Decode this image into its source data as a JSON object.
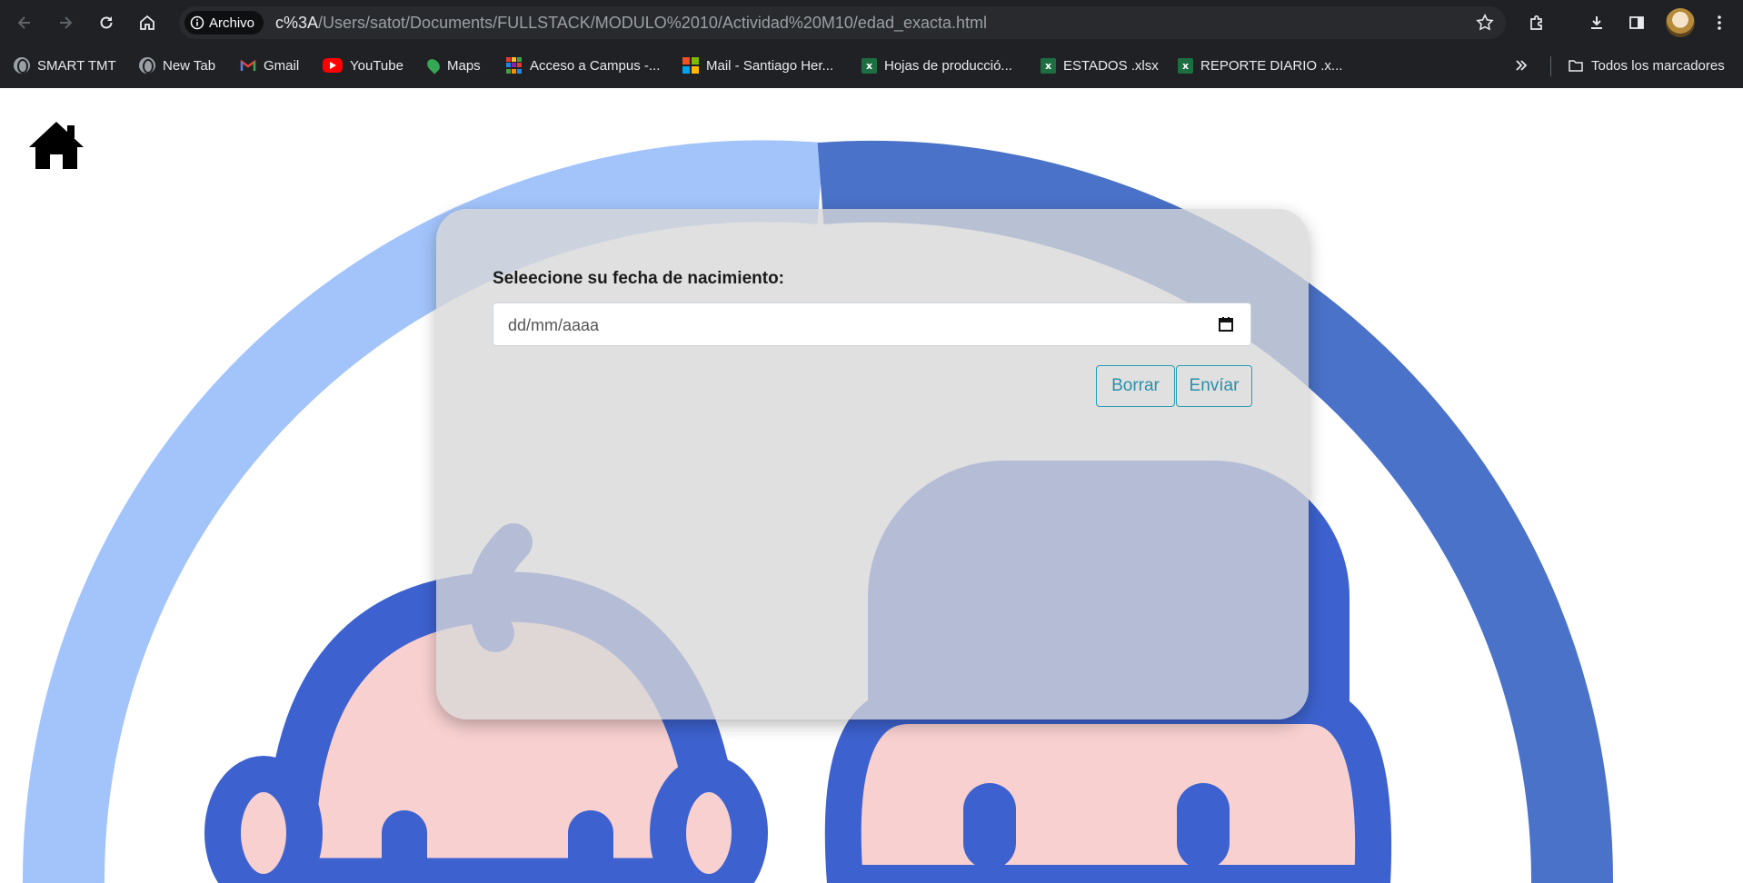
{
  "browser": {
    "site_chip": "Archivo",
    "url_host": "c%3A",
    "url_path": "/Users/satot/Documents/FULLSTACK/MODULO%2010/Actividad%20M10/edad_exacta.html",
    "bookmarks": [
      {
        "label": "SMART TMT",
        "icon": "globe-icon"
      },
      {
        "label": "New Tab",
        "icon": "globe-icon"
      },
      {
        "label": "Gmail",
        "icon": "gmail-icon"
      },
      {
        "label": "YouTube",
        "icon": "youtube-icon"
      },
      {
        "label": "Maps",
        "icon": "maps-icon"
      },
      {
        "label": "Acceso a Campus -...",
        "icon": "grid-icon"
      },
      {
        "label": "Mail - Santiago Her...",
        "icon": "microsoft-icon"
      },
      {
        "label": "Hojas de producció...",
        "icon": "excel-icon"
      },
      {
        "label": "ESTADOS .xlsx",
        "icon": "excel-icon"
      },
      {
        "label": "REPORTE DIARIO .x...",
        "icon": "excel-icon"
      }
    ],
    "all_bookmarks": "Todos los marcadores"
  },
  "form": {
    "label": "Seleecione su fecha de nacimiento:",
    "date_placeholder": "dd/mm/aaaa",
    "clear_button": "Borrar",
    "submit_button": "Envíar"
  },
  "colors": {
    "accent": "#2a9bb3",
    "art_blue": "#3d62cf",
    "art_light_blue": "#a2c4fb",
    "art_pink": "#f8d0d0"
  }
}
